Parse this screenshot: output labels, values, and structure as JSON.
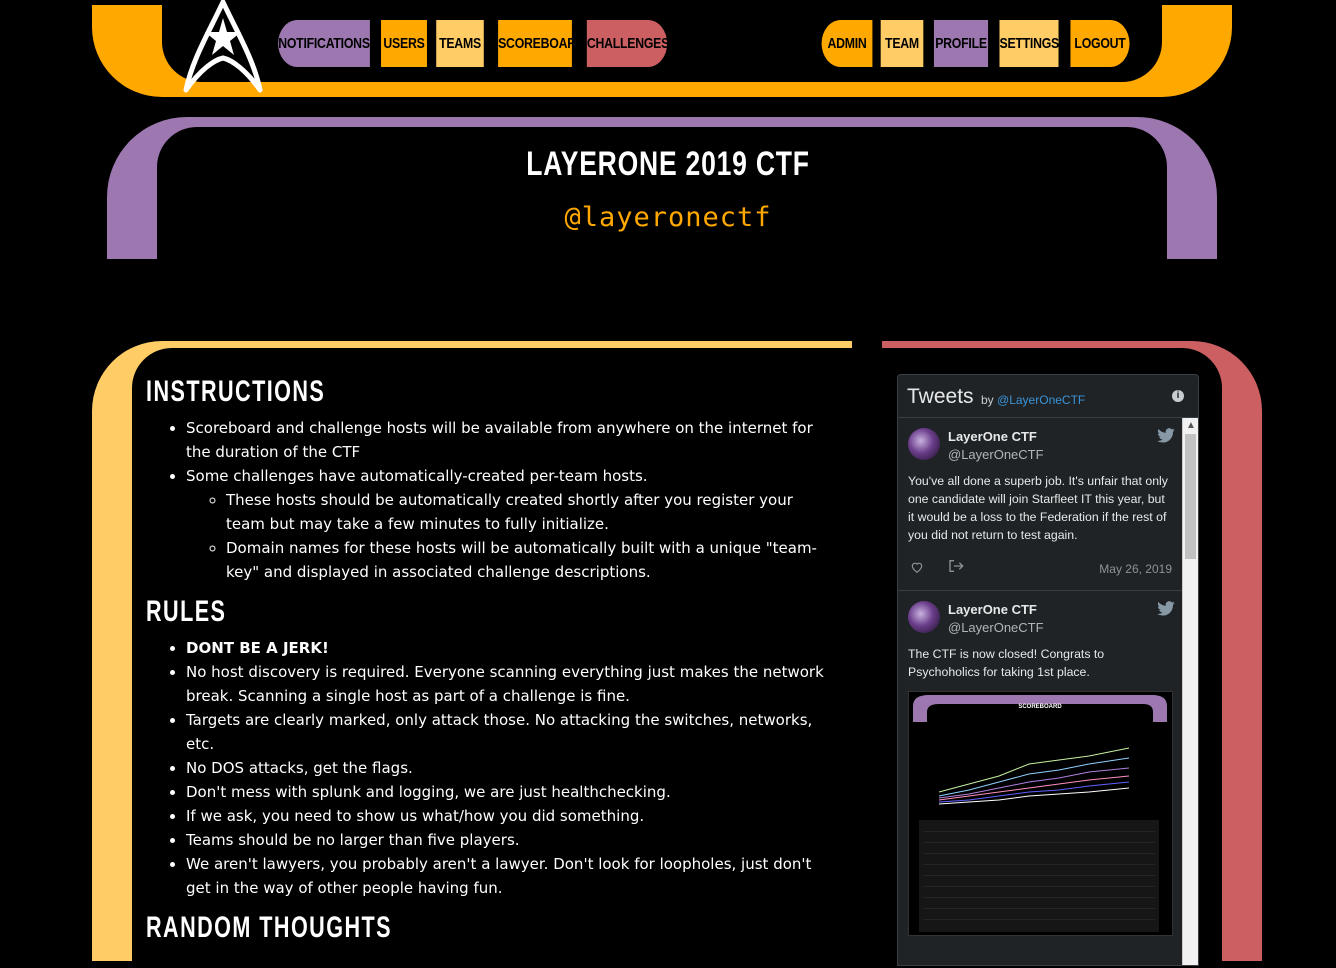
{
  "nav": {
    "left": [
      "NOTIFICATIONS",
      "USERS",
      "TEAMS",
      "SCOREBOARD",
      "CHALLENGES"
    ],
    "right": [
      "ADMIN",
      "TEAM",
      "PROFILE",
      "SETTINGS",
      "LOGOUT"
    ]
  },
  "header": {
    "title": "LAYERONE 2019 CTF",
    "handle": "@layeronectf"
  },
  "instructions": {
    "heading": "INSTRUCTIONS",
    "items": [
      "Scoreboard and challenge hosts will be available from anywhere on the internet for the duration of the CTF",
      "Some challenges have automatically-created per-team hosts."
    ],
    "subitems": [
      "These hosts should be automatically created shortly after you register your team but may take a few minutes to fully initialize.",
      "Domain names for these hosts will be automatically built with a unique \"team-key\" and displayed in associated challenge descriptions."
    ]
  },
  "rules": {
    "heading": "RULES",
    "items": [
      "DONT BE A JERK!",
      "No host discovery is required. Everyone scanning everything just makes the network break. Scanning a single host as part of a challenge is fine.",
      "Targets are clearly marked, only attack those. No attacking the switches, networks, etc.",
      "No DOS attacks, get the flags.",
      "Don't mess with splunk and logging, we are just healthchecking.",
      "If we ask, you need to show us what/how you did something.",
      "Teams should be no larger than five players.",
      "We aren't lawyers, you probably aren't a lawyer. Don't look for loopholes, just don't get in the way of other people having fun."
    ]
  },
  "random": {
    "heading": "RANDOM THOUGHTS"
  },
  "tweets_widget": {
    "title": "Tweets",
    "by": "by",
    "account": "@LayerOneCTF",
    "tweets": [
      {
        "name": "LayerOne CTF",
        "handle": "@LayerOneCTF",
        "text": "You've all done a superb job.  It's unfair that only one candidate will join Starfleet IT this year, but it would be a loss to the Federation if the rest of you did not return to test again.",
        "date": "May 26, 2019"
      },
      {
        "name": "LayerOne CTF",
        "handle": "@LayerOneCTF",
        "text": "The CTF is now closed!  Congrats to Psychoholics for taking 1st place.",
        "image_label": "SCOREBOARD"
      }
    ]
  },
  "colors": {
    "orange": "#ffa800",
    "purple": "#9c77b0",
    "peach": "#ffcc66",
    "red": "#cc5f61"
  }
}
